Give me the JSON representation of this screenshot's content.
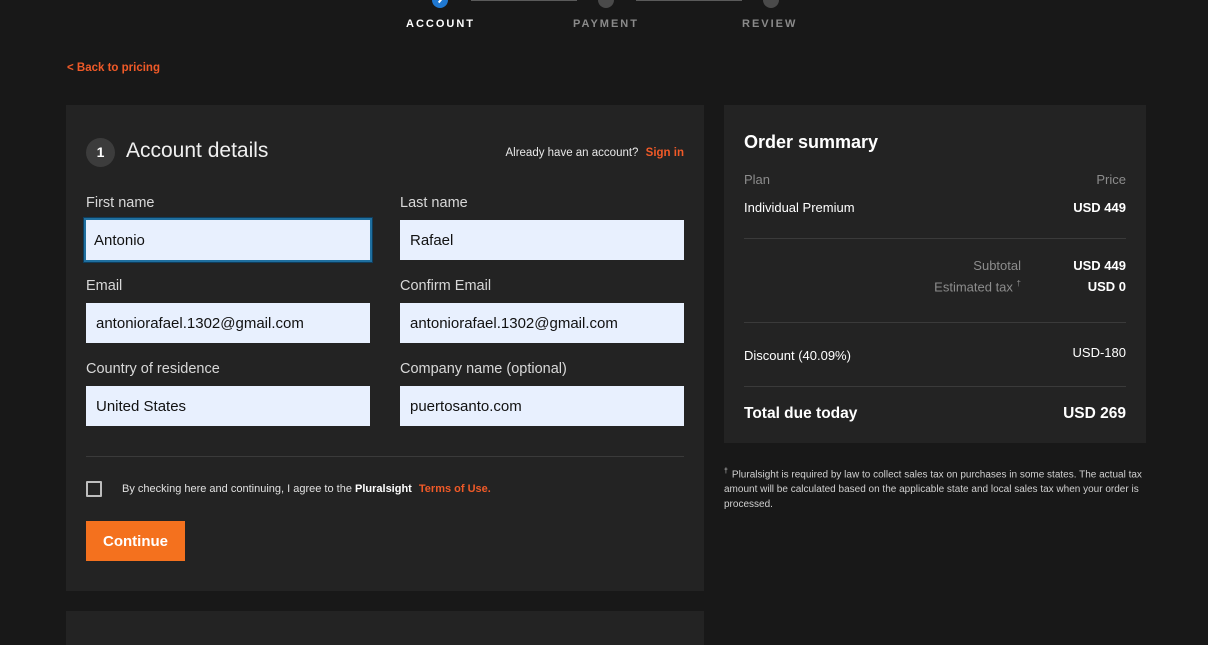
{
  "stepper": {
    "steps": [
      {
        "label": "ACCOUNT",
        "active": true
      },
      {
        "label": "PAYMENT",
        "active": false
      },
      {
        "label": "REVIEW",
        "active": false
      }
    ]
  },
  "back_link": "< Back to pricing",
  "account": {
    "step_number": "1",
    "title": "Account details",
    "signin_prompt": "Already have an account?",
    "signin_link": "Sign in",
    "fields": {
      "first_name": {
        "label": "First name",
        "value": "Antonio"
      },
      "last_name": {
        "label": "Last name",
        "value": "Rafael"
      },
      "email": {
        "label": "Email",
        "value": "antoniorafael.1302@gmail.com"
      },
      "confirm_email": {
        "label": "Confirm Email",
        "value": "antoniorafael.1302@gmail.com"
      },
      "country": {
        "label": "Country of residence",
        "value": "United States"
      },
      "company": {
        "label": "Company name (optional)",
        "value": "puertosanto.com"
      }
    },
    "terms_text": "By checking here and continuing, I agree to the",
    "terms_brand": "Pluralsight",
    "terms_link": "Terms of Use.",
    "continue_label": "Continue"
  },
  "summary": {
    "title": "Order summary",
    "plan_header": "Plan",
    "price_header": "Price",
    "plan_name": "Individual Premium",
    "plan_price": "USD 449",
    "subtotal_label": "Subtotal",
    "subtotal_value": "USD 449",
    "tax_label": "Estimated tax",
    "tax_mark": "†",
    "tax_value": "USD 0",
    "discount_label": "Discount (40.09%)",
    "discount_value": "USD-180",
    "total_label": "Total due today",
    "total_value": "USD 269"
  },
  "footnote": {
    "mark": "†",
    "text": "Pluralsight is required by law to collect sales tax on purchases in some states. The actual tax amount will be calculated based on the applicable state and local sales tax when your order is processed."
  },
  "colors": {
    "accent": "#f05a28",
    "button": "#f4711e",
    "step_active": "#1f78d1"
  }
}
